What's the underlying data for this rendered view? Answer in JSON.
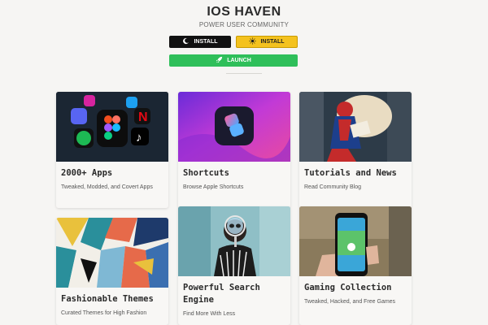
{
  "header": {
    "title": "IOS HAVEN",
    "subtitle": "POWER USER COMMUNITY"
  },
  "buttons": {
    "install_dark": "INSTALL",
    "install_light": "INSTALL",
    "launch": "LAUNCH"
  },
  "cards": [
    {
      "title": "2000+ Apps",
      "description": "Tweaked, Modded, and Covert Apps"
    },
    {
      "title": "Shortcuts",
      "description": "Browse Apple Shortcuts"
    },
    {
      "title": "Tutorials and News",
      "description": "Read Community Blog"
    },
    {
      "title": "Fashionable Themes",
      "description": "Curated Themes for High Fashion"
    },
    {
      "title": "Powerful Search Engine",
      "description": "Find More With Less"
    },
    {
      "title": "Gaming Collection",
      "description": "Tweaked, Hacked, and Free Games"
    }
  ],
  "colors": {
    "install_dark_bg": "#111111",
    "install_light_bg": "#f4c21e",
    "launch_bg": "#2fbf5a",
    "page_bg": "#f6f5f3"
  },
  "icons": {
    "install_dark": "moon-icon",
    "install_light": "sun-icon",
    "launch": "rocket-icon"
  }
}
